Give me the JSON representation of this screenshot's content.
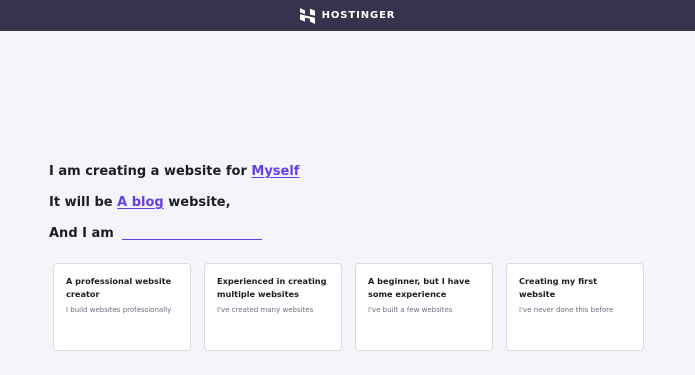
{
  "header": {
    "brand": "HOSTINGER"
  },
  "sentences": {
    "line1_prefix": "I am creating a website for",
    "line1_choice": "Myself",
    "line2_prefix": "It will be",
    "line2_choice": "A blog",
    "line2_suffix": "website,",
    "line3_prefix": "And I am"
  },
  "experience_options": [
    {
      "title": "A professional website creator",
      "subtitle": "I build websites professionally"
    },
    {
      "title": "Experienced in creating multiple websites",
      "subtitle": "I've created many websites"
    },
    {
      "title": "A beginner, but I have some experience",
      "subtitle": "I've built a few websites"
    },
    {
      "title": "Creating my first website",
      "subtitle": "I've never done this before"
    }
  ],
  "colors": {
    "header_bg": "#36344d",
    "page_bg": "#f4f4fb",
    "accent": "#673de6"
  }
}
